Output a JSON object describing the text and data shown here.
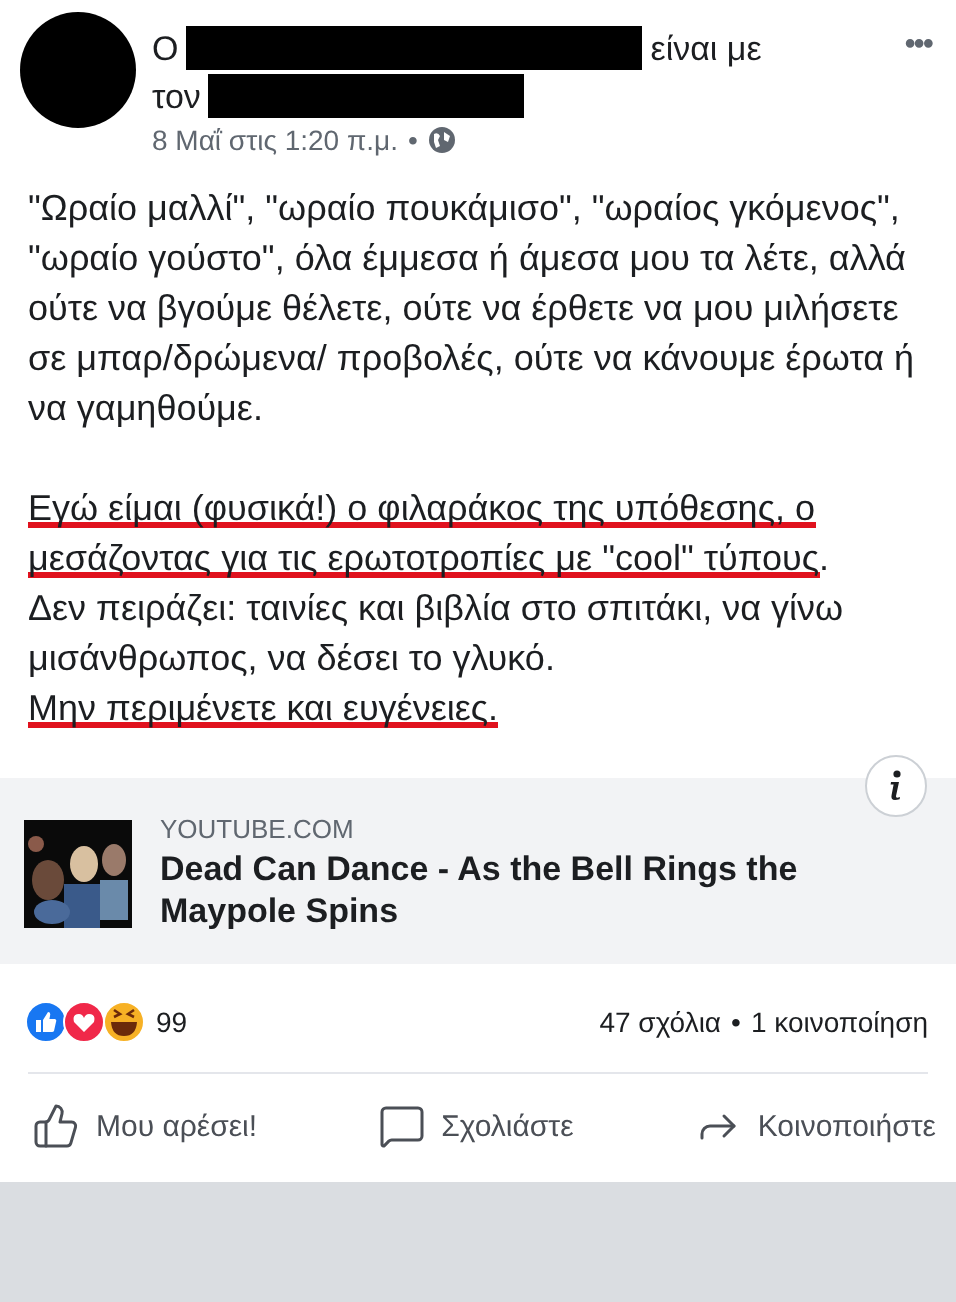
{
  "post": {
    "author_prefix": "Ο",
    "with_text": "είναι με",
    "tag_prefix": "τον",
    "timestamp": "8 Μαΐ στις 1:20 π.μ.",
    "separator": "•",
    "menu": "•••",
    "paragraphs": [
      [
        [
          {
            "text": "\"Ωραίο μαλλί\", \"ωραίο πουκάμισο\", \"ωραίος γκόμενος\", \"ωραίο γούστο\", όλα έμμεσα ή άμεσα μου τα λέτε, αλλά ούτε να βγούμε θέλετε, ούτε να έρθετε να μου μιλήσετε σε μπαρ/δρώμενα/ προβολές, ούτε να κάνουμε έρωτα ή να γαμηθούμε.",
            "underlined": false
          }
        ]
      ],
      [
        [
          {
            "text": "Εγώ είμαι (φυσικά!) ο φιλαράκος της υπόθεσης, ο μεσάζοντας για τις ερωτοτροπίες με \"cool\" τύπους",
            "underlined": true
          },
          {
            "text": ".",
            "underlined": false
          }
        ],
        [
          {
            "text": "Δεν πειράζει: ταινίες και βιβλία στο σπιτάκι, να γίνω μισάνθρωπος, να δέσει το γλυκό.",
            "underlined": false
          }
        ],
        [
          {
            "text": "Μην περιμένετε και ευγένειες.",
            "underlined": true
          }
        ]
      ]
    ]
  },
  "link_preview": {
    "domain": "YOUTUBE.COM",
    "title": "Dead Can Dance - As the Bell Rings the Maypole Spins"
  },
  "stats": {
    "reaction_count": "99",
    "comments": "47 σχόλια",
    "separator": "•",
    "shares": "1 κοινοποίηση"
  },
  "actions": [
    {
      "kind": "like",
      "label": "Μου αρέσει!"
    },
    {
      "kind": "comment",
      "label": "Σχολιάστε"
    },
    {
      "kind": "share",
      "label": "Κοινοποιήστε"
    }
  ]
}
